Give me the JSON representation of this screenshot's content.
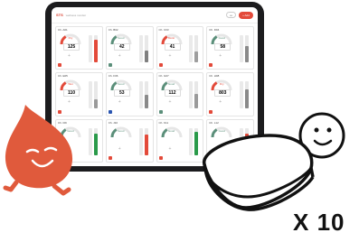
{
  "app": {
    "brand": "STS",
    "brand_sub": "wellness monitor",
    "toolbar_pill": "•••",
    "toolbar_action": "+ Add"
  },
  "tiles": [
    {
      "header": "Ch. A01",
      "name": "Dry",
      "value": "125",
      "fill": 0.85,
      "gauge_color": "#e34a3a",
      "fill_color": "#e34a3a",
      "dot_color": "#e34a3a"
    },
    {
      "header": "Ch. B02",
      "name": "Good",
      "value": "42",
      "fill": 0.45,
      "gauge_color": "#5b8f7a",
      "fill_color": "#7f7f7f",
      "dot_color": "#5b8f7a"
    },
    {
      "header": "Ch. C03",
      "name": "Moist",
      "value": "41",
      "fill": 0.4,
      "gauge_color": "#e34a3a",
      "fill_color": "#9e9e9e",
      "dot_color": "#e34a3a"
    },
    {
      "header": "Ch. D04",
      "name": "Good",
      "value": "58",
      "fill": 0.6,
      "gauge_color": "#5b8f7a",
      "fill_color": "#8a8a8a",
      "dot_color": "#e34a3a"
    },
    {
      "header": "Ch. E05",
      "name": "Wet",
      "value": "110",
      "fill": 0.35,
      "gauge_color": "#e34a3a",
      "fill_color": "#9a9a9a",
      "dot_color": "#e34a3a"
    },
    {
      "header": "Ch. F06",
      "name": "Good",
      "value": "53",
      "fill": 0.5,
      "gauge_color": "#5b8f7a",
      "fill_color": "#8a8a8a",
      "dot_color": "#2a55b0"
    },
    {
      "header": "Ch. G07",
      "name": "Good",
      "value": "112",
      "fill": 0.55,
      "gauge_color": "#5b8f7a",
      "fill_color": "#9a9a9a",
      "dot_color": "#5b8f7a"
    },
    {
      "header": "Ch. H08",
      "name": "Dry",
      "value": "803",
      "fill": 0.7,
      "gauge_color": "#e34a3a",
      "fill_color": "#8a8a8a",
      "dot_color": "#e34a3a"
    },
    {
      "header": "Ch. I09",
      "name": "Good",
      "value": "",
      "fill": 0.8,
      "gauge_color": "#5b8f7a",
      "fill_color": "#2a9a4a",
      "dot_color": "#e34a3a"
    },
    {
      "header": "Ch. J10",
      "name": "Good",
      "value": "",
      "fill": 0.75,
      "gauge_color": "#5b8f7a",
      "fill_color": "#e34a3a",
      "dot_color": "#e34a3a"
    },
    {
      "header": "Ch. K11",
      "name": "Good",
      "value": "",
      "fill": 0.85,
      "gauge_color": "#5b8f7a",
      "fill_color": "#2a9a4a",
      "dot_color": "#e34a3a"
    },
    {
      "header": "Ch. L12",
      "name": "Good",
      "value": "",
      "fill": 0.8,
      "gauge_color": "#5b8f7a",
      "fill_color": "#e34a3a",
      "dot_color": "#e34a3a"
    }
  ],
  "caption": "X 10",
  "colors": {
    "accent": "#e34a3a",
    "mascot": "#e05a3c",
    "ink": "#111111"
  },
  "icons": {
    "drop_mascot": "water-drop-character",
    "sensor": "sensor-pod-character"
  }
}
